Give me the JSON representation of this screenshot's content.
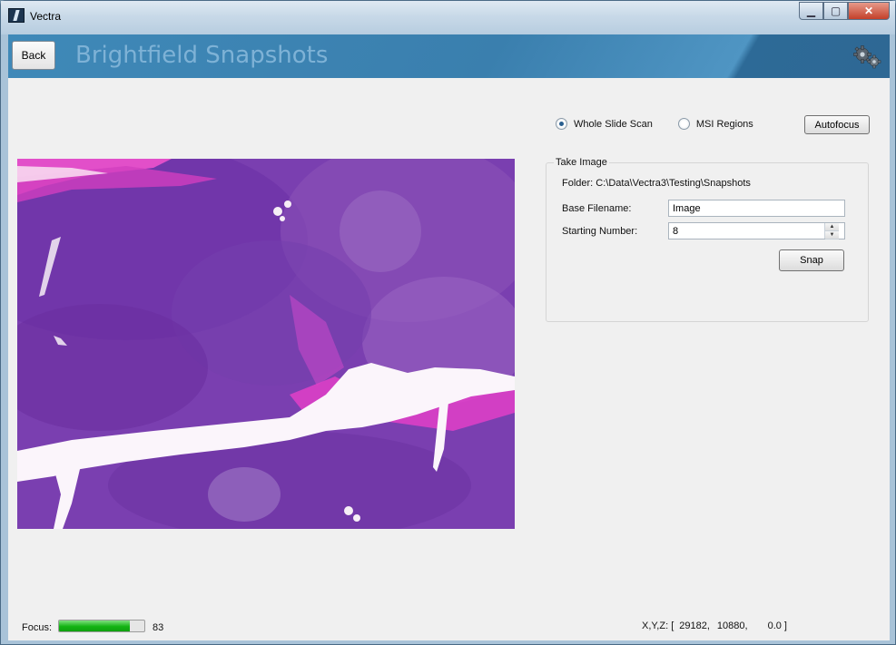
{
  "window": {
    "title": "Vectra",
    "minimize_icon": "minimize-icon",
    "maximize_icon": "maximize-icon",
    "close_icon": "close-icon",
    "minimize_glyph": "▁",
    "maximize_glyph": "▢",
    "close_glyph": "✕"
  },
  "header": {
    "back_label": "Back",
    "title": "Brightfield Snapshots",
    "settings_icon": "gears-icon"
  },
  "scan_mode": {
    "options": [
      {
        "label": "Whole Slide Scan",
        "checked": true
      },
      {
        "label": "MSI Regions",
        "checked": false
      }
    ],
    "autofocus_label": "Autofocus"
  },
  "take_image": {
    "legend": "Take Image",
    "folder_text": "Folder: C:\\Data\\Vectra3\\Testing\\Snapshots",
    "base_filename_label": "Base Filename:",
    "base_filename_value": "Image",
    "starting_number_label": "Starting Number:",
    "starting_number_value": "8",
    "spin_up": "▲",
    "spin_down": "▼",
    "snap_label": "Snap"
  },
  "status": {
    "focus_label": "Focus:",
    "focus_fraction": 0.83,
    "focus_value": "83",
    "xyz_label": "X,Y,Z: [",
    "x": "29182,",
    "y": "10880,",
    "z": "0.0 ]"
  },
  "colors": {
    "header_blue": "#3a7fae",
    "progress_green": "#13b313",
    "tissue_purple": "#7a3fb0",
    "tissue_pink": "#e23fc8"
  }
}
